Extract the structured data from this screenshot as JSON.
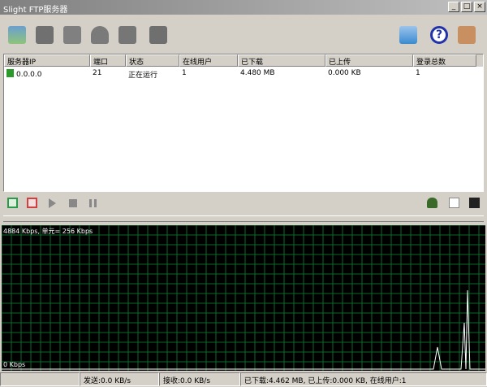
{
  "window": {
    "title": "Slight FTP服务器",
    "min": "_",
    "max": "□",
    "close": "×"
  },
  "list": {
    "columns": [
      "服务器IP",
      "端口",
      "状态",
      "在线用户",
      "已下载",
      "已上传",
      "登录总数"
    ],
    "rows": [
      [
        "0.0.0.0",
        "21",
        "正在运行",
        "1",
        "4.480 MB",
        "0.000 KB",
        "1"
      ]
    ]
  },
  "graph": {
    "top_label": "4884 Kbps, 单元= 256 Kbps",
    "bottom_label": "0 Kbps"
  },
  "status": {
    "send": "发送:0.0 KB/s",
    "receive": "接收:0.0 KB/s",
    "summary": "已下载:4.462 MB, 已上传:0.000 KB, 在线用户:1"
  }
}
